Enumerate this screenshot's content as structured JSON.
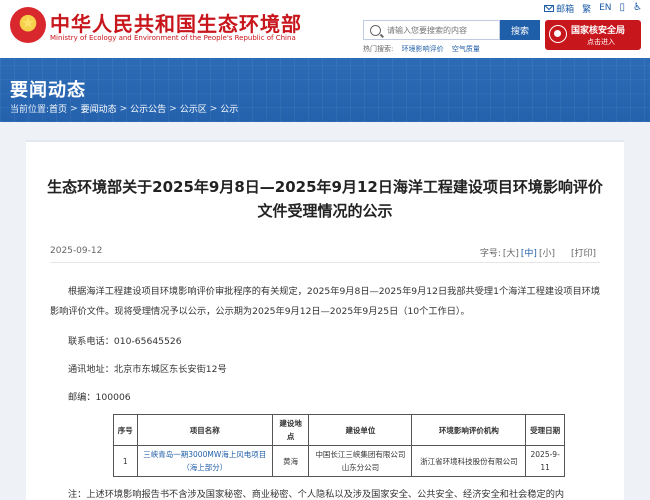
{
  "header": {
    "emblem_glyph": "★",
    "site_title": "中华人民共和国生态环境部",
    "site_subtitle": "Ministry of Ecology and Environment of the People's Republic of China",
    "toplinks": [
      {
        "label": "邮箱",
        "icon": "mail-icon"
      },
      {
        "label": "繁",
        "icon": ""
      },
      {
        "label": "EN",
        "icon": ""
      },
      {
        "label": "",
        "icon": "mobile-icon"
      },
      {
        "label": "",
        "icon": "accessibility-icon"
      }
    ],
    "search_placeholder": "请输入您要搜索的内容",
    "search_button": "搜索",
    "hot_label": "热门搜索:",
    "hot_items": [
      "环境影响评价",
      "空气质量"
    ],
    "nnsa_title": "国家核安全局",
    "nnsa_sub": "点击进入"
  },
  "banner": {
    "title": "要闻动态",
    "breadcrumb_prefix": "当前位置:",
    "breadcrumb": [
      "首页",
      "要闻动态",
      "公示公告",
      "公示区",
      "公示"
    ]
  },
  "article": {
    "title": "生态环境部关于2025年9月8日—2025年9月12日海洋工程建设项目环境影响评价文件受理情况的公示",
    "date": "2025-09-12",
    "font_label": "字号:",
    "font_sizes": [
      "[大]",
      "[中]",
      "[小]"
    ],
    "font_size_selected": 1,
    "print": "[打印]",
    "paragraph": "根据海洋工程建设项目环境影响评价审批程序的有关规定，2025年9月8日—2025年9月12日我部共受理1个海洋工程建设项目环境影响评价文件。现将受理情况予以公示，公示期为2025年9月12日—2025年9月25日（10个工作日）。",
    "phone": "联系电话：010-65645526",
    "address": "通讯地址：北京市东城区东长安街12号",
    "zip": "邮编：100006",
    "table": {
      "headers": [
        "序号",
        "项目名称",
        "建设地点",
        "建设单位",
        "环境影响评价机构",
        "受理日期"
      ],
      "rows": [
        [
          "1",
          "三峡青岛一期3000MW海上风电项目（海上部分）",
          "黄海",
          "中国长江三峡集团有限公司山东分公司",
          "浙江省环境科技股份有限公司",
          "2025-9-11"
        ]
      ]
    },
    "note": "注：上述环境影响报告书不含涉及国家秘密、商业秘密、个人隐私以及涉及国家安全、公共安全、经济安全和社会稳定的内"
  },
  "colors": {
    "brand_red": "#c8161d",
    "brand_blue": "#1f5ea8",
    "banner_blue": "#2d6bb6"
  }
}
